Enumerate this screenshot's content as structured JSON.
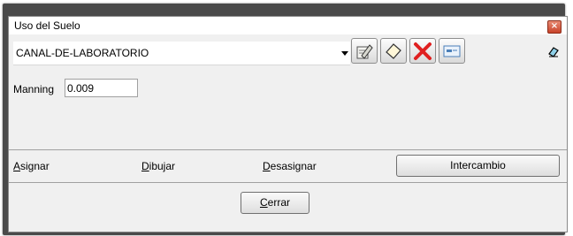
{
  "window": {
    "title": "Uso del Suelo",
    "close_glyph": "×"
  },
  "combo": {
    "selected": "CANAL-DE-LABORATORIO"
  },
  "toolbar": {
    "icons": [
      "edit-pencil-icon",
      "erase-icon",
      "delete-x-icon",
      "properties-icon"
    ],
    "eraser_icon": "eraser-icon"
  },
  "manning": {
    "label": "Manning",
    "value": "0.009"
  },
  "tabs": {
    "asignar": {
      "mnemonic": "A",
      "rest": "signar"
    },
    "dibujar": {
      "mnemonic": "D",
      "rest": "ibujar"
    },
    "desasignar": {
      "mnemonic": "D",
      "rest": "esasignar"
    },
    "intercambio": "Intercambio"
  },
  "footer": {
    "cerrar": {
      "mnemonic": "C",
      "rest": "errar"
    }
  },
  "colors": {
    "delete_red": "#e02020",
    "window_bg": "#f0f0f0",
    "frame": "#4a4a4a"
  }
}
